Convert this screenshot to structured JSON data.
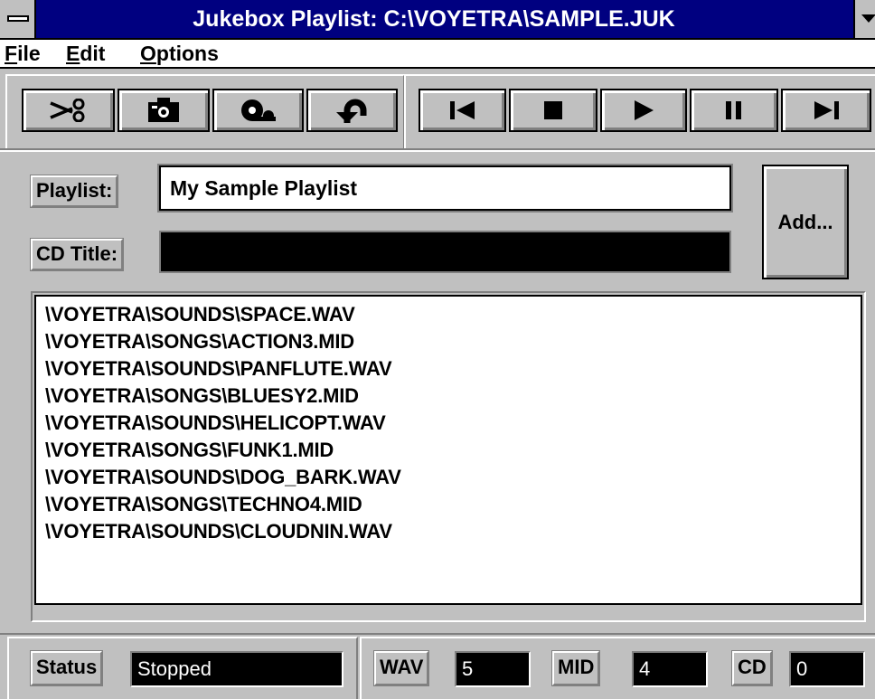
{
  "window": {
    "title": "Jukebox Playlist: C:\\VOYETRA\\SAMPLE.JUK"
  },
  "icons": [
    "system-menu-icon",
    "minimize-arrow-icon",
    "scissors-icon",
    "camera-icon",
    "tape-icon",
    "undo-icon",
    "skip-back-icon",
    "stop-icon",
    "play-icon",
    "pause-icon",
    "skip-forward-icon"
  ],
  "menu": {
    "file": {
      "mnemonic": "F",
      "rest": "ile"
    },
    "edit": {
      "mnemonic": "E",
      "rest": "dit"
    },
    "options": {
      "mnemonic": "O",
      "rest": "ptions"
    }
  },
  "form": {
    "playlist_label": "Playlist:",
    "playlist_value": "My Sample Playlist",
    "cd_title_label": "CD Title:",
    "cd_title_value": "",
    "add_label": "Add..."
  },
  "files": [
    "\\VOYETRA\\SOUNDS\\SPACE.WAV",
    "\\VOYETRA\\SONGS\\ACTION3.MID",
    "\\VOYETRA\\SOUNDS\\PANFLUTE.WAV",
    "\\VOYETRA\\SONGS\\BLUESY2.MID",
    "\\VOYETRA\\SOUNDS\\HELICOPT.WAV",
    "\\VOYETRA\\SONGS\\FUNK1.MID",
    "\\VOYETRA\\SOUNDS\\DOG_BARK.WAV",
    "\\VOYETRA\\SONGS\\TECHNO4.MID",
    "\\VOYETRA\\SOUNDS\\CLOUDNIN.WAV"
  ],
  "status": {
    "status_label": "Status",
    "status_value": "Stopped",
    "wav_label": "WAV",
    "wav_count": "5",
    "mid_label": "MID",
    "mid_count": "4",
    "cd_label": "CD",
    "cd_count": "0"
  }
}
